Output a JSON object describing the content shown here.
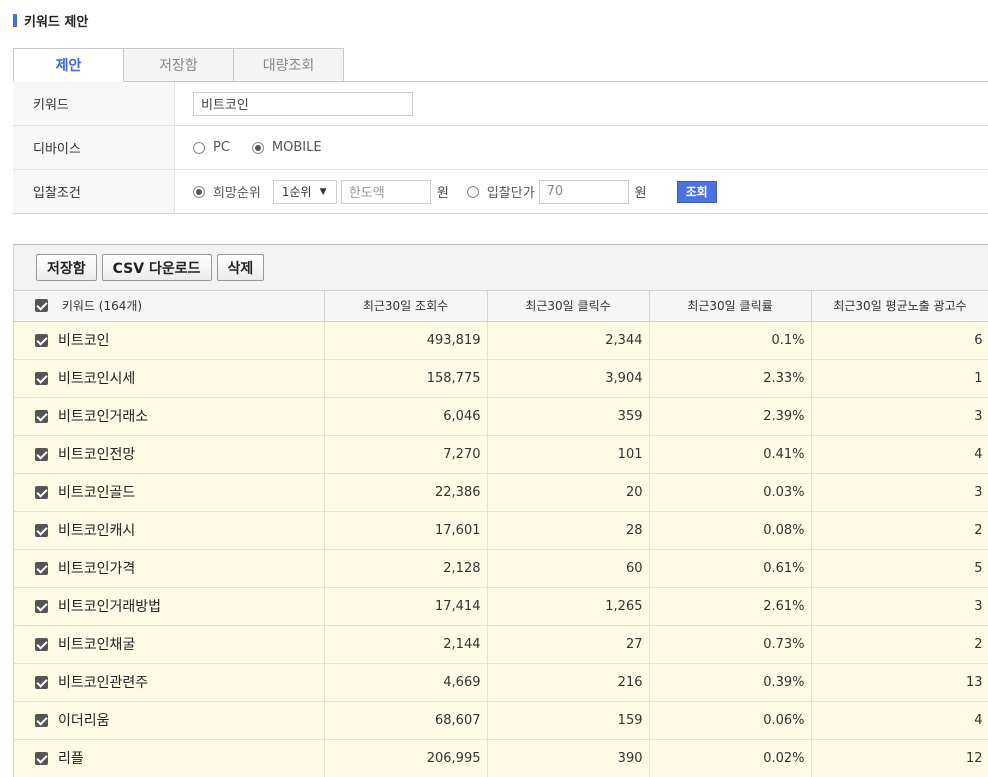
{
  "section": {
    "title": "키워드 제안"
  },
  "tabs": [
    {
      "label": "제안",
      "active": true
    },
    {
      "label": "저장함",
      "active": false
    },
    {
      "label": "대량조회",
      "active": false
    }
  ],
  "form": {
    "keyword_label": "키워드",
    "keyword_value": "비트코인",
    "device_label": "디바이스",
    "device_options": [
      "PC",
      "MOBILE"
    ],
    "device_selected": "MOBILE",
    "bid_label": "입찰조건",
    "bid_option_rank": "희망순위",
    "rank_value": "1순위",
    "limit_placeholder": "한도액",
    "unit": "원",
    "bid_option_price": "입찰단가",
    "price_value": "70",
    "search_button": "조회"
  },
  "toolbar": {
    "save_label": "저장함",
    "csv_label": "CSV 다운로드",
    "delete_label": "삭제"
  },
  "table": {
    "headers": {
      "keyword": "키워드 (164개)",
      "views": "최근30일 조회수",
      "clicks": "최근30일 클릭수",
      "ctr": "최근30일 클릭률",
      "ads": "최근30일 평균노출 광고수"
    },
    "rows": [
      {
        "keyword": "비트코인",
        "views": "493,819",
        "clicks": "2,344",
        "ctr": "0.1%",
        "ads": "6"
      },
      {
        "keyword": "비트코인시세",
        "views": "158,775",
        "clicks": "3,904",
        "ctr": "2.33%",
        "ads": "1"
      },
      {
        "keyword": "비트코인거래소",
        "views": "6,046",
        "clicks": "359",
        "ctr": "2.39%",
        "ads": "3"
      },
      {
        "keyword": "비트코인전망",
        "views": "7,270",
        "clicks": "101",
        "ctr": "0.41%",
        "ads": "4"
      },
      {
        "keyword": "비트코인골드",
        "views": "22,386",
        "clicks": "20",
        "ctr": "0.03%",
        "ads": "3"
      },
      {
        "keyword": "비트코인캐시",
        "views": "17,601",
        "clicks": "28",
        "ctr": "0.08%",
        "ads": "2"
      },
      {
        "keyword": "비트코인가격",
        "views": "2,128",
        "clicks": "60",
        "ctr": "0.61%",
        "ads": "5"
      },
      {
        "keyword": "비트코인거래방법",
        "views": "17,414",
        "clicks": "1,265",
        "ctr": "2.61%",
        "ads": "3"
      },
      {
        "keyword": "비트코인채굴",
        "views": "2,144",
        "clicks": "27",
        "ctr": "0.73%",
        "ads": "2"
      },
      {
        "keyword": "비트코인관련주",
        "views": "4,669",
        "clicks": "216",
        "ctr": "0.39%",
        "ads": "13"
      },
      {
        "keyword": "이더리움",
        "views": "68,607",
        "clicks": "159",
        "ctr": "0.06%",
        "ads": "4"
      },
      {
        "keyword": "리플",
        "views": "206,995",
        "clicks": "390",
        "ctr": "0.02%",
        "ads": "12"
      }
    ]
  },
  "colors": {
    "accent": "#4a72e0",
    "row_highlight": "#fefbe5",
    "tab_active_text": "#3a66d8"
  },
  "icons": {
    "checkbox": "checkbox-checked-icon",
    "caret": "chevron-down-icon"
  }
}
